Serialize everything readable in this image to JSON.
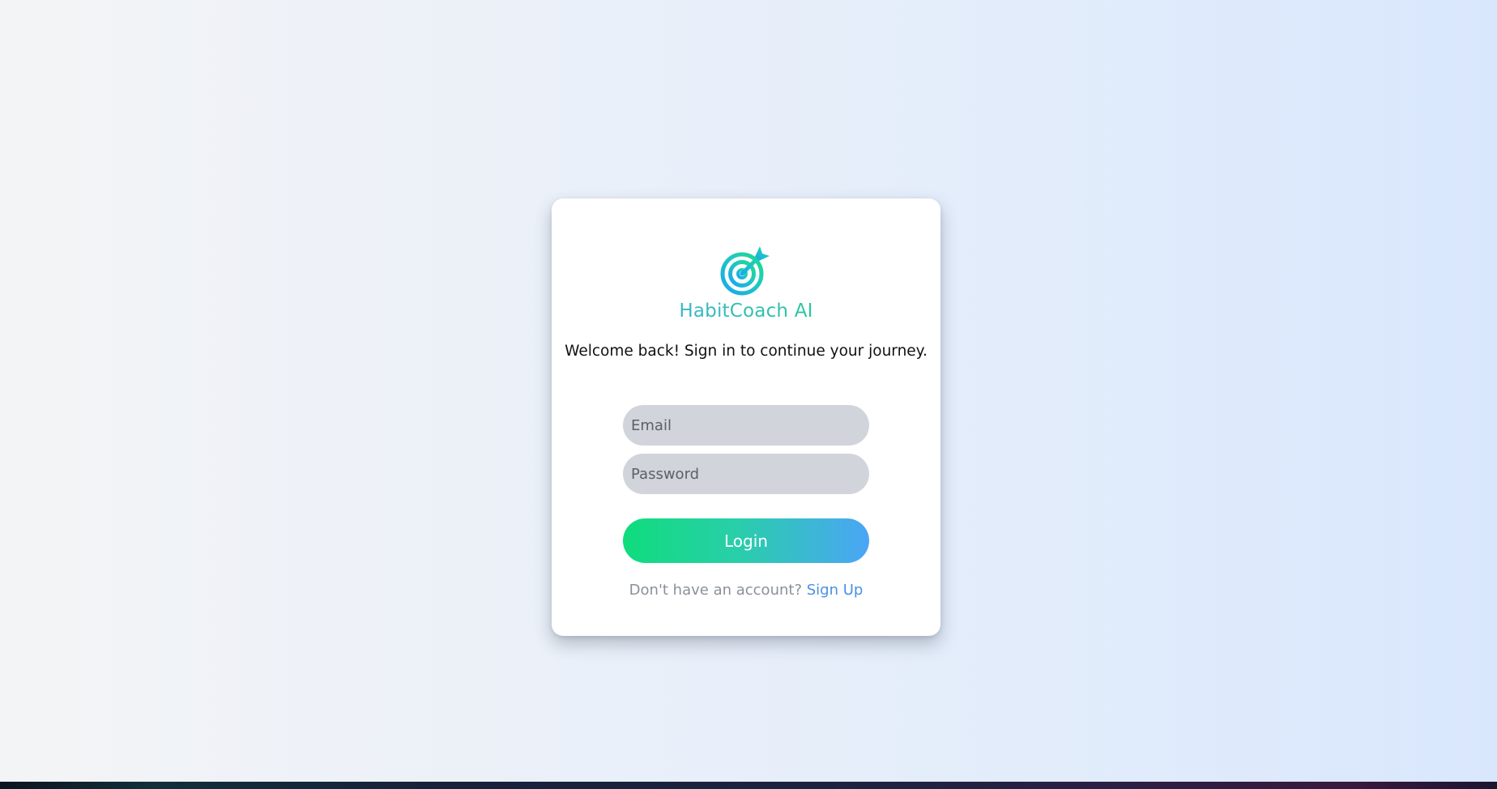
{
  "app": {
    "brand": "HabitCoach AI",
    "logo_icon": "target-arrow-icon",
    "welcome": "Welcome back! Sign in to continue your journey."
  },
  "form": {
    "email_placeholder": "Email",
    "email_value": "",
    "password_placeholder": "Password",
    "password_value": "",
    "login_label": "Login"
  },
  "footer": {
    "prompt": "Don't have an account?",
    "signup_label": "Sign Up"
  },
  "colors": {
    "gradient_start": "#0fdc7c",
    "gradient_end": "#4ba5f6",
    "link": "#4a90e2",
    "input_bg": "#d1d5db"
  }
}
